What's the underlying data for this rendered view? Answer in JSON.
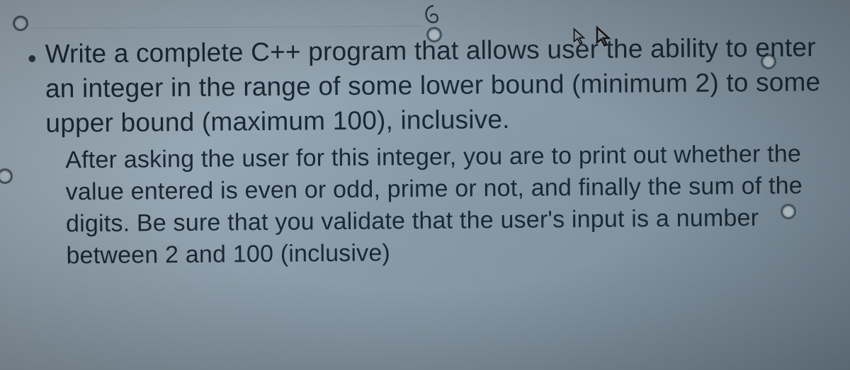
{
  "assignment": {
    "main_instruction": "Write a complete C++ program that allows user the ability to enter an integer in the range of some lower bound (minimum 2) to some upper bound (maximum 100), inclusive.",
    "sub_instruction": "After asking the user for this integer, you are to print out whether the value entered is even or odd, prime or not, and finally the sum of the digits. Be sure that you validate that the user's input is a number between 2 and 100 (inclusive)",
    "lower_bound": 2,
    "upper_bound": 100
  },
  "icons": {
    "cursor": "cursor-arrow",
    "sketch": "at-spiral"
  }
}
